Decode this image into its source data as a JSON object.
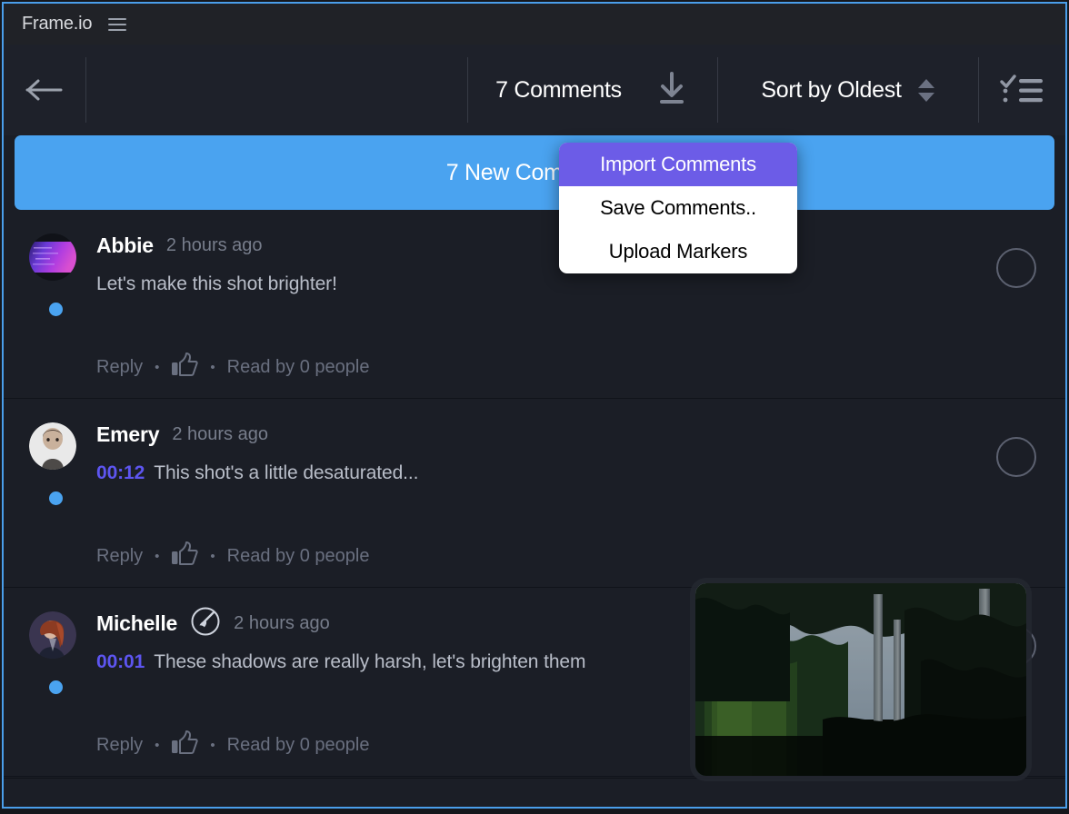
{
  "brand": {
    "title": "Frame.io",
    "menu_icon": "hamburger-icon"
  },
  "toolbar": {
    "back_icon": "arrow-left-icon",
    "comment_count_label": "7 Comments",
    "download_icon": "download-icon",
    "sort_label": "Sort by Oldest",
    "sort_caret_icon": "caret-updown-icon",
    "checklist_icon": "checklist-icon"
  },
  "banner": {
    "label": "7 New Comments"
  },
  "dropdown": {
    "items": [
      {
        "label": "Import Comments",
        "active": true
      },
      {
        "label": "Save Comments..",
        "active": false
      },
      {
        "label": "Upload Markers",
        "active": false
      }
    ]
  },
  "comments": [
    {
      "author": "Abbie",
      "time": "2 hours ago",
      "timecode": "",
      "text": "Let's make this shot brighter!",
      "reply_label": "Reply",
      "read_label": "Read by 0 people",
      "like_icon": "thumbs-up-icon",
      "avatar": "abbie-avatar",
      "has_annotation": false,
      "unread": true
    },
    {
      "author": "Emery",
      "time": "2 hours ago",
      "timecode": "00:12",
      "text": "This shot's a little desaturated...",
      "reply_label": "Reply",
      "read_label": "Read by 0 people",
      "like_icon": "thumbs-up-icon",
      "avatar": "emery-avatar",
      "has_annotation": false,
      "unread": true
    },
    {
      "author": "Michelle",
      "time": "2 hours ago",
      "timecode": "00:01",
      "text": "These shadows are really harsh, let's brighten them",
      "reply_label": "Reply",
      "read_label": "Read by 0 people",
      "like_icon": "thumbs-up-icon",
      "avatar": "michelle-avatar",
      "has_annotation": true,
      "annotation_icon": "paintbrush-circle-icon",
      "unread": true
    }
  ],
  "video_thumbnail": {
    "name": "forest-frame-thumbnail",
    "description": "Dark forest with tall pine trees and pale sky"
  },
  "colors": {
    "accent_blue": "#4aa3f0",
    "accent_purple": "#6c5ce7",
    "timecode_purple": "#5d55f0",
    "window_border": "#4a9eea",
    "background": "#1b1e26",
    "toolbar_bg": "#1e212a",
    "brand_bar_bg": "#202227"
  }
}
